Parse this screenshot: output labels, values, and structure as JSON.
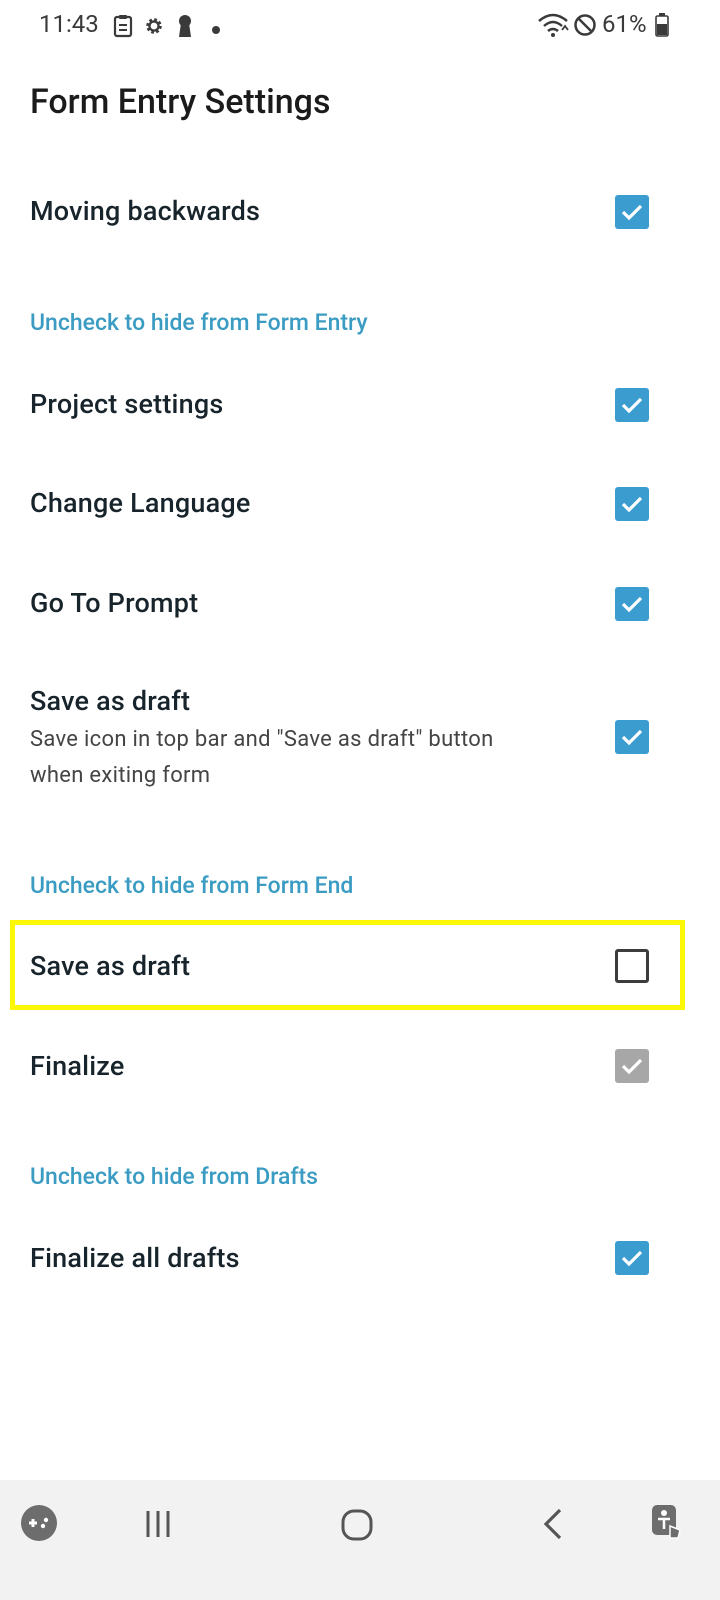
{
  "status_bar": {
    "time": "11:43",
    "battery_percent": "61%",
    "left_icons": [
      "clipboard-icon",
      "gear-icon",
      "keyhole-icon",
      "dot-icon"
    ],
    "right_icons": [
      "wifi-icon",
      "do-not-disturb-icon",
      "battery-icon"
    ]
  },
  "page": {
    "title": "Form Entry Settings"
  },
  "settings": {
    "moving_backwards": {
      "label": "Moving backwards",
      "checked": true
    },
    "section_form_entry": "Uncheck to hide from Form Entry",
    "project_settings": {
      "label": "Project settings",
      "checked": true
    },
    "change_language": {
      "label": "Change Language",
      "checked": true
    },
    "go_to_prompt": {
      "label": "Go To Prompt",
      "checked": true
    },
    "save_as_draft_entry": {
      "label": "Save as draft",
      "description": "Save icon in top bar and \"Save as draft\" button when exiting form",
      "checked": true
    },
    "section_form_end": "Uncheck to hide from Form End",
    "save_as_draft_end": {
      "label": "Save as draft",
      "checked": false,
      "highlighted": true
    },
    "finalize": {
      "label": "Finalize",
      "checked": true,
      "disabled": true
    },
    "section_drafts": "Uncheck to hide from Drafts",
    "finalize_all_drafts": {
      "label": "Finalize all drafts",
      "checked": true
    }
  },
  "nav_bar": {
    "icons": [
      "game-launcher-icon",
      "recent-apps-icon",
      "home-icon",
      "back-icon",
      "accessibility-icon"
    ]
  },
  "colors": {
    "accent": "#3b9cd0",
    "section_text": "#3a9cc2",
    "highlight": "#fbf706",
    "disabled_check": "#9e9e9e"
  }
}
